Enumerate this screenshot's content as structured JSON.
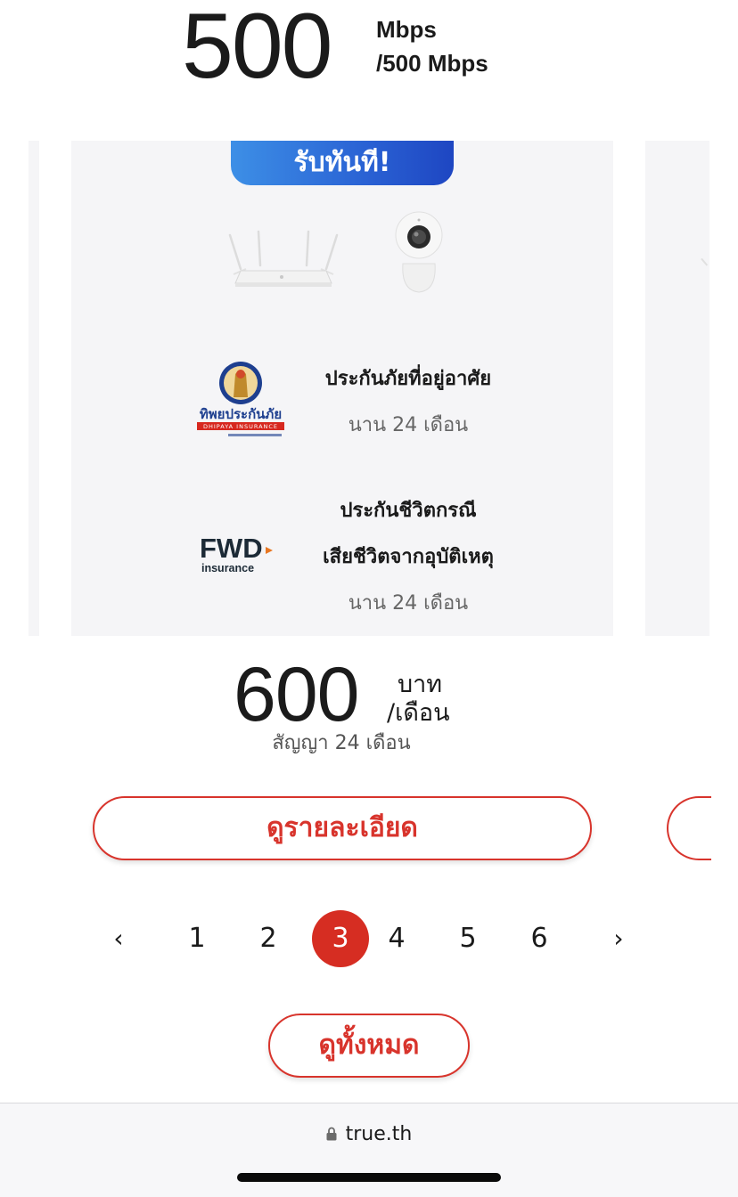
{
  "speed": {
    "value": "500",
    "unit_line1": "Mbps",
    "unit_line2": "/500 Mbps"
  },
  "card": {
    "badge": "รับทันที!",
    "devices": [
      "router-icon",
      "camera-icon"
    ],
    "insurance": [
      {
        "logo": "dhipaya-insurance-logo",
        "logo_text": "ทิพยประกันภัย",
        "logo_subtext": "DHIPAYA INSURANCE",
        "title_lines": [
          "ประกันภัยที่อยู่อาศัย"
        ],
        "duration": "นาน 24 เดือน"
      },
      {
        "logo": "fwd-insurance-logo",
        "logo_text": "FWD",
        "logo_subtext": "insurance",
        "title_lines": [
          "ประกันชีวิตกรณี",
          "เสียชีวิตจากอุบัติเหตุ"
        ],
        "duration": "นาน 24 เดือน"
      }
    ]
  },
  "price": {
    "value": "600",
    "unit_line1": "บาท",
    "unit_line2": "/เดือน",
    "contract": "สัญญา 24 เดือน"
  },
  "buttons": {
    "detail": "ดูรายละเอียด",
    "view_all": "ดูทั้งหมด"
  },
  "pagination": {
    "prev": "‹",
    "next": "›",
    "pages": [
      "1",
      "2",
      "3",
      "4",
      "5",
      "6"
    ],
    "current": "3"
  },
  "browser": {
    "url": "true.th"
  },
  "colors": {
    "accent_red": "#d62d22",
    "badge_blue": "#2a62d4",
    "card_bg": "#f5f5f7"
  }
}
